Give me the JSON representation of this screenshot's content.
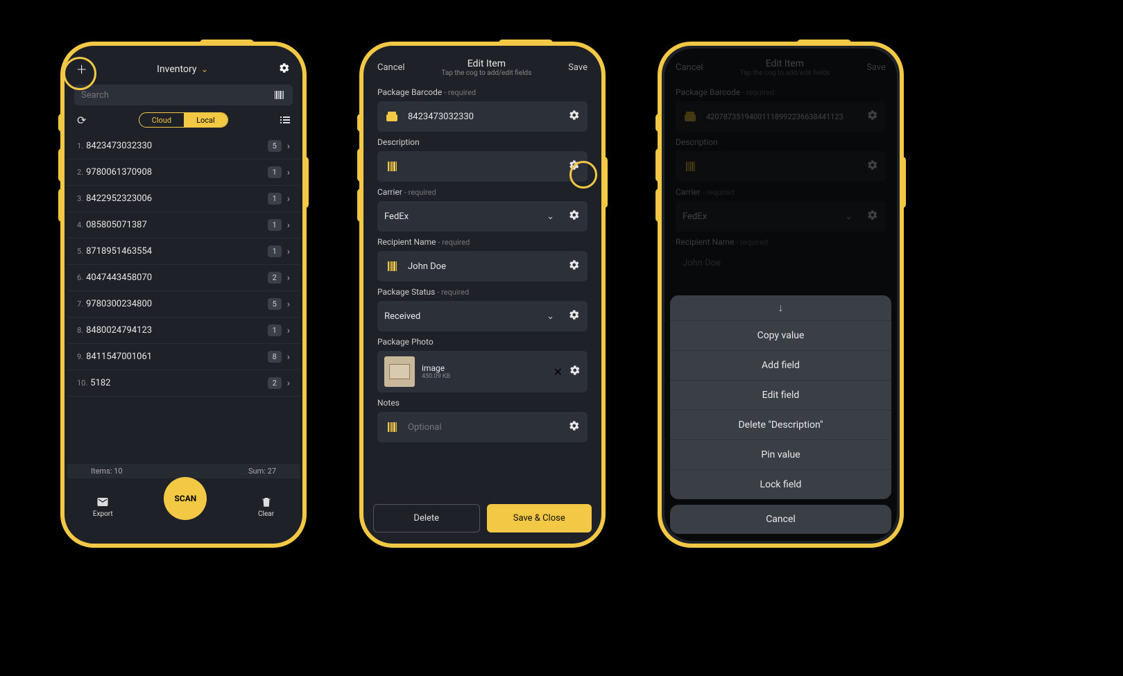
{
  "phone1": {
    "title": "Inventory",
    "search_placeholder": "Search",
    "cloud_label": "Cloud",
    "local_label": "Local",
    "items": [
      {
        "idx": "1.",
        "code": "8423473032330",
        "count": "5"
      },
      {
        "idx": "2.",
        "code": "9780061370908",
        "count": "1"
      },
      {
        "idx": "3.",
        "code": "8422952323006",
        "count": "1"
      },
      {
        "idx": "4.",
        "code": "085805071387",
        "count": "1"
      },
      {
        "idx": "5.",
        "code": "8718951463554",
        "count": "1"
      },
      {
        "idx": "6.",
        "code": "4047443458070",
        "count": "2"
      },
      {
        "idx": "7.",
        "code": "9780300234800",
        "count": "5"
      },
      {
        "idx": "8.",
        "code": "8480024794123",
        "count": "1"
      },
      {
        "idx": "9.",
        "code": "8411547001061",
        "count": "8"
      },
      {
        "idx": "10.",
        "code": "5182",
        "count": "2"
      }
    ],
    "items_label": "Items: 10",
    "sum_label": "Sum: 27",
    "scan_label": "SCAN",
    "export_label": "Export",
    "clear_label": "Clear"
  },
  "phone2": {
    "cancel_label": "Cancel",
    "title": "Edit Item",
    "subtitle": "Tap the cog to add/edit fields",
    "save_label": "Save",
    "fields": {
      "barcode": {
        "label": "Package Barcode",
        "req": "- required",
        "value": "8423473032330"
      },
      "description": {
        "label": "Description",
        "value": ""
      },
      "carrier": {
        "label": "Carrier",
        "req": "- required",
        "value": "FedEx"
      },
      "recipient": {
        "label": "Recipient Name",
        "req": "- required",
        "value": "John Doe"
      },
      "status": {
        "label": "Package Status",
        "req": "- required",
        "value": "Received"
      },
      "photo": {
        "label": "Package Photo",
        "name": "image",
        "size": "450.09 KB"
      },
      "notes": {
        "label": "Notes",
        "placeholder": "Optional"
      }
    },
    "delete_label": "Delete",
    "saveclose_label": "Save & Close"
  },
  "phone3": {
    "cancel_label": "Cancel",
    "title": "Edit Item",
    "subtitle": "Tap the cog to add/edit fields",
    "save_label": "Save",
    "fields": {
      "barcode": {
        "label": "Package Barcode",
        "req": "- required",
        "value": "42078735194001118992236638441123"
      },
      "description": {
        "label": "Description"
      },
      "carrier": {
        "label": "Carrier",
        "req": "- required",
        "value": "FedEx"
      },
      "recipient": {
        "label": "Recipient Name",
        "req": "- required",
        "value": "John Doe"
      }
    },
    "sheet": {
      "arrow": "↓",
      "copy": "Copy value",
      "add": "Add field",
      "edit": "Edit field",
      "delete": "Delete \"Description\"",
      "pin": "Pin value",
      "lock": "Lock field",
      "cancel": "Cancel"
    }
  }
}
